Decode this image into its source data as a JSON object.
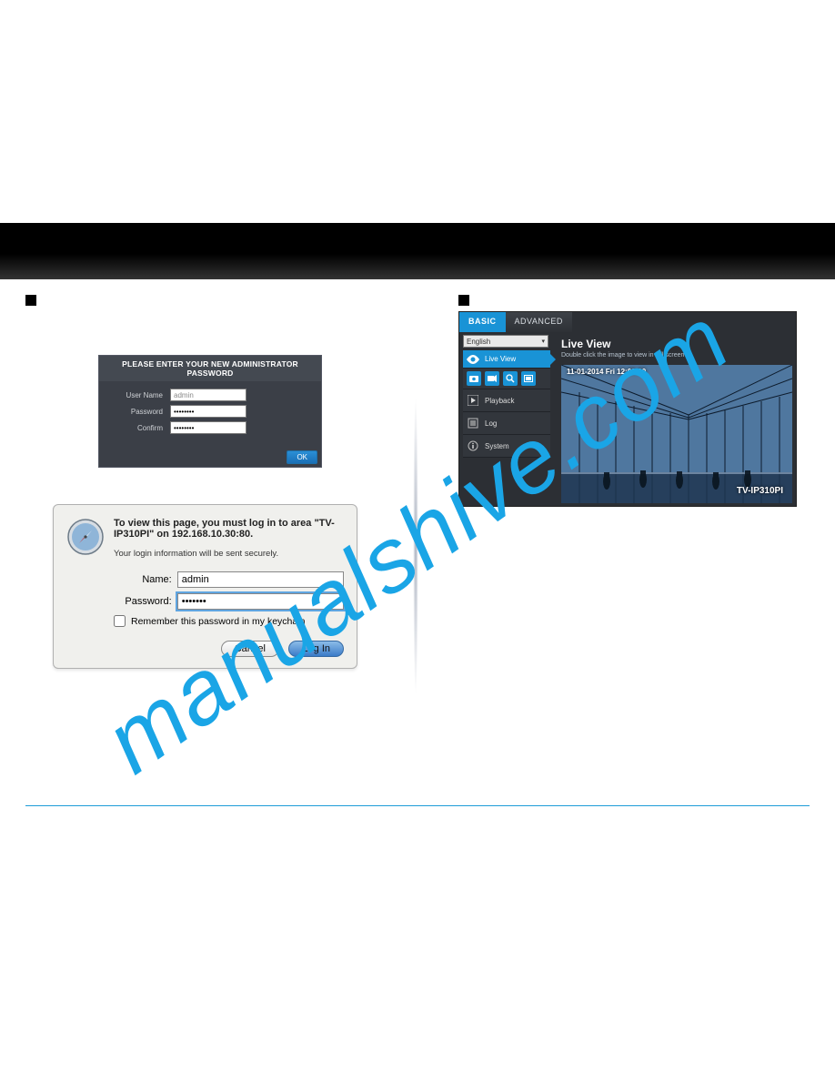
{
  "watermark": "manualshive.com",
  "left": {
    "admin_box": {
      "title": "PLEASE ENTER YOUR NEW ADMINISTRATOR PASSWORD",
      "username_label": "User Name",
      "username_value": "admin",
      "password_label": "Password",
      "password_value": "••••••••",
      "confirm_label": "Confirm",
      "confirm_value": "••••••••",
      "ok": "OK"
    },
    "mac_dialog": {
      "line1a": "To view this page, you must log in to area \"TV-",
      "line1b": "IP310PI\" on 192.168.10.30:80.",
      "secure": "Your login information will be sent securely.",
      "name_label": "Name:",
      "name_value": "admin",
      "password_label": "Password:",
      "password_value": "•••••••",
      "remember": "Remember this password in my keychain",
      "cancel": "Cancel",
      "login": "Log In"
    }
  },
  "right": {
    "tabs": {
      "basic": "BASIC",
      "advanced": "ADVANCED"
    },
    "language": "English",
    "header_title": "Live View",
    "header_sub": "Double click the image to view in full screen",
    "sidebar": {
      "live_view": "Live View",
      "playback": "Playback",
      "log": "Log",
      "system": "System"
    },
    "video": {
      "timestamp": "11-01-2014  Fri 12:00:00",
      "model": "TV-IP310PI"
    }
  }
}
